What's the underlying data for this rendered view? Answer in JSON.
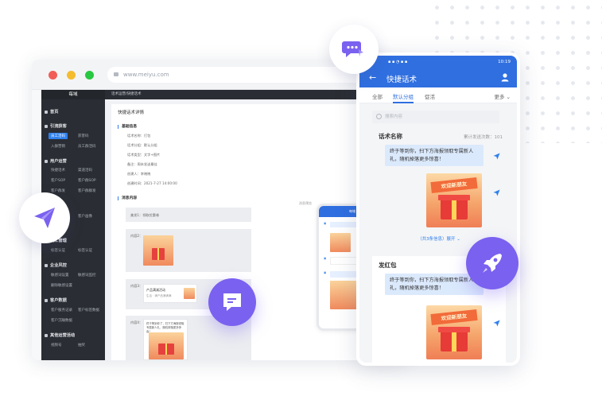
{
  "window": {
    "url": "www.meiyu.com",
    "brand": "每域",
    "breadcrumb": "话术运营/快捷话术",
    "page_title": "快捷话术详情",
    "sections": {
      "basic": "基础信息",
      "content": "消息内容"
    },
    "fields": [
      "话术名称：打包",
      "话术分组：默认分组",
      "话术类型：文字+图片",
      "备注：周末发送最佳",
      "创建人：李晓晓",
      "创建时间：2021-7-27 14:00:00"
    ],
    "message_labels": [
      "文本1：",
      "内容2：",
      "内容3：",
      "内容4："
    ],
    "msg_text": "美发1：领取优惠卷",
    "preview_label": "消息预览",
    "card_title": "产品满减活动",
    "card_sub": "生活 · 满产品满满满",
    "card_long": "终于等到你了，扫下方海报领取专属新人礼，随机掉落更多惊喜！"
  },
  "sidebar": {
    "sections": [
      {
        "label": "首页"
      },
      {
        "label": "引流获客",
        "items": [
          "员工活码",
          "获客码",
          "入群营销",
          "员工群活码"
        ]
      },
      {
        "label": "用户运营",
        "items": [
          "快捷话术",
          "渠道活码",
          "客户SOP",
          "客户群SOP",
          "客户群发",
          "客户群群发"
        ]
      },
      {
        "label": "客户画像"
      },
      {
        "label": "员工管理",
        "items": [
          "标签认证",
          "标签认证"
        ]
      },
      {
        "label": "企业风控",
        "items": [
          "敏感词设置",
          "敏感词监控",
          "删除敏感设置"
        ]
      },
      {
        "label": "客户数据",
        "items": [
          "客户服务记录",
          "客户标签数据",
          "客户沉睡数据"
        ]
      },
      {
        "label": "其他运营活动",
        "items": [
          "视频号",
          "抽奖"
        ]
      }
    ]
  },
  "phone": {
    "status_time": "10:19",
    "title": "快捷话术",
    "tabs": [
      "全部",
      "默认分组",
      "促活"
    ],
    "tab_more": "更多",
    "search_placeholder": "搜索内容",
    "groups": [
      {
        "title": "话术名称",
        "meta": "累计发送次数：101",
        "bubble": "终于等到你，扫下方海报领取专属新人礼，随机掉落更多惊喜！",
        "expand": "（共3条信息）展开"
      },
      {
        "title": "发红包",
        "meta": "累",
        "bubble": "终于等到你，扫下方海报领取专属新人礼，随机掉落更多惊喜！"
      }
    ],
    "poster_banner": "欢迎新朋友"
  },
  "colors": {
    "accent": "#2f6fe0",
    "float_purple": "#7b61f0",
    "sidebar_bg": "#2a2d33"
  },
  "icons": {
    "chat": "chat-bubbles-icon",
    "send": "paper-plane-icon",
    "message": "message-square-icon",
    "rocket": "rocket-icon"
  }
}
